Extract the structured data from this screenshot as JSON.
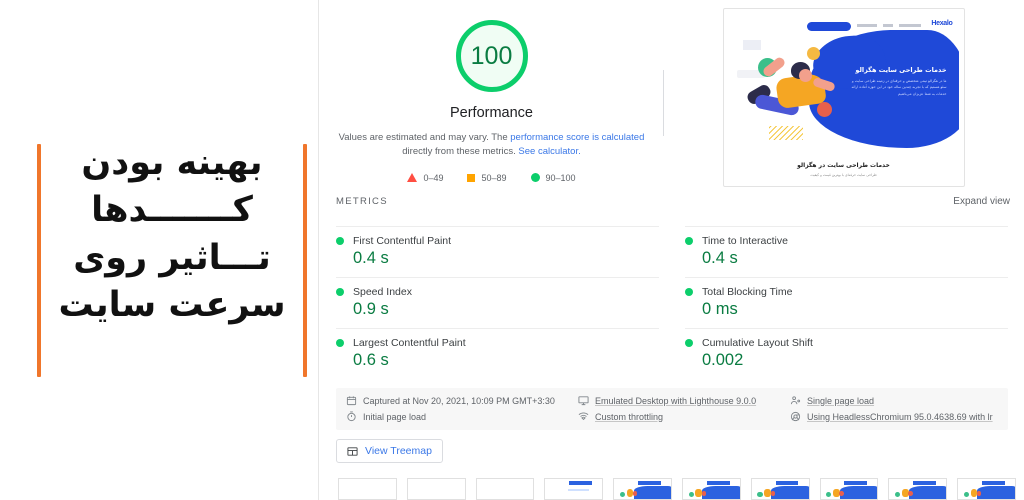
{
  "left_callout": {
    "lines": [
      "بهینه بودن",
      "کـــــــدها",
      "تـــاثیر روی",
      "سرعت سایت"
    ],
    "accent_color": "#F0762B"
  },
  "score": {
    "value": "100",
    "label": "Performance",
    "note_part1": "Values are estimated and may vary. The ",
    "note_link1": "performance score is calculated",
    "note_part2": " directly from these metrics. ",
    "note_link2": "See calculator.",
    "ring_color": "#0CCE6B",
    "number_color": "#0A7C42",
    "legend": [
      {
        "icon": "triangle-icon",
        "range": "0–49",
        "color": "#FF4E42"
      },
      {
        "icon": "square-icon",
        "range": "50–89",
        "color": "#FFA400"
      },
      {
        "icon": "circle-icon",
        "range": "90–100",
        "color": "#0CCE6B"
      }
    ]
  },
  "screenshot": {
    "site_logo": "Hexalo",
    "hero_heading": "خدمات طراحی سایت هگزالو",
    "hero_body": "ما در هگزالو تیمی متخصص و حرفه‌ای در زمینه طراحی سایت و سئو هستیم که با تجربه چندین ساله خود در این حوزه آماده ارائه خدمات به شما عزیزان می‌باشیم",
    "caption": "خدمات طراحی سایت در هگزالو",
    "caption_sub": "طراحی سایت حرفه‌ای با بهترین قیمت و کیفیت"
  },
  "metrics_section": {
    "title": "METRICS",
    "expand_view": "Expand view",
    "items": [
      {
        "name": "First Contentful Paint",
        "value": "0.4 s",
        "status_color": "#0CCE6B"
      },
      {
        "name": "Time to Interactive",
        "value": "0.4 s",
        "status_color": "#0CCE6B"
      },
      {
        "name": "Speed Index",
        "value": "0.9 s",
        "status_color": "#0CCE6B"
      },
      {
        "name": "Total Blocking Time",
        "value": "0 ms",
        "status_color": "#0CCE6B"
      },
      {
        "name": "Largest Contentful Paint",
        "value": "0.6 s",
        "status_color": "#0CCE6B"
      },
      {
        "name": "Cumulative Layout Shift",
        "value": "0.002",
        "status_color": "#0CCE6B"
      }
    ]
  },
  "environment": {
    "captured_at": "Captured at Nov 20, 2021, 10:09 PM GMT+3:30",
    "emulation": "Emulated Desktop with Lighthouse 9.0.0",
    "page_load_type_single": "Single page load",
    "initial_page_load": "Initial page load",
    "throttling": "Custom throttling",
    "user_agent": "Using HeadlessChromium 95.0.4638.69 with lr"
  },
  "treemap": {
    "label": "View Treemap",
    "icon": "treemap-icon"
  },
  "filmstrip": {
    "frame_count": 10,
    "loaded_from_index": 3
  }
}
